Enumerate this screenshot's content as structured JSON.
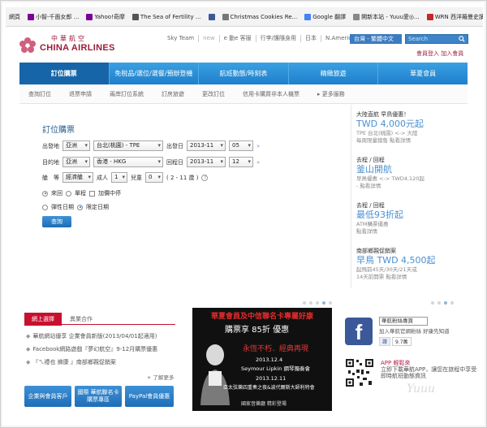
{
  "bookmarks": {
    "label": "網頁",
    "items": [
      {
        "label": "小智-千面女郎 ...",
        "icon": "yahoo-icon",
        "color": "#7b0099"
      },
      {
        "label": "Yahoo!奇摩",
        "icon": "yahoo-icon",
        "color": "#7b0099"
      },
      {
        "label": "The Sea of Fertility ...",
        "icon": "page-icon",
        "color": "#444444"
      },
      {
        "label": "",
        "icon": "facebook-icon",
        "color": "#3b5998"
      },
      {
        "label": "Christmas Cookies Re...",
        "icon": "page-icon",
        "color": "#444444"
      },
      {
        "label": "Google 翻譯",
        "icon": "google-icon",
        "color": "#4285f4"
      },
      {
        "label": "開新本站 - Yuuu愛◎...",
        "icon": "page-icon",
        "color": "#444444"
      },
      {
        "label": "WRN 西洋羅曼史讀...",
        "icon": "page-icon",
        "color": "#c62828"
      }
    ]
  },
  "header": {
    "logo_cn": "中華航空",
    "logo_en": "CHINA AIRLINES",
    "topnav": [
      "Sky Team",
      "new",
      "e 動e 客服",
      "行李/護隨身用",
      "日本",
      "N.America"
    ],
    "region": "台灣 - 繁體中文",
    "search_placeholder": "Search",
    "member_login": "會員登入",
    "join": "加入會員"
  },
  "mainnav": [
    "訂位購票",
    "免稅品/選位/選餐/預辦登機",
    "航班動態/時刻表",
    "精緻旅遊",
    "華夏會員"
  ],
  "subnav": [
    "查詢訂位",
    "退票申請",
    "兩岸訂位系統",
    "訂房旅遊",
    "更改訂位",
    "信用卡購買非本人機票",
    "更多服務"
  ],
  "booking": {
    "title": "訂位購票",
    "depart_label": "出發地",
    "depart_region": "亞洲",
    "depart_city": "台北(桃園) - TPE",
    "depart_date_label": "出發日",
    "depart_month": "2013-11",
    "depart_day": "05",
    "dest_label": "目的地",
    "dest_region": "亞洲",
    "dest_city": "香港 - HKG",
    "return_date_label": "回程日",
    "return_month": "2013-11",
    "return_day": "12",
    "cabin_label": "艙　等",
    "cabin_value": "經濟艙",
    "adult_label": "成人",
    "adult_count": "1",
    "child_label": "兒童",
    "child_count": "0",
    "child_age": "( 2 - 11 歲 )",
    "trip_roundtrip": "來回",
    "trip_oneway": "單程",
    "stopover": "加價中停",
    "flex_date": "彈性日期",
    "fixed_date": "限定日期",
    "query_button": "查詢"
  },
  "promos": [
    {
      "title": "大陸直航 早鳥優惠！",
      "price": "TWD 4,000元起",
      "lines": [
        "TPE 台北(桃園) <-> 大陸",
        "每周限量銷售 點看詳情"
      ]
    },
    {
      "title": "去程 / 回程",
      "price": "釜山開航",
      "lines": [
        "早鳥優惠 <-> TWD4,120起",
        "- 點看詳情"
      ]
    },
    {
      "title": "去程 / 回程",
      "price": "最低93折起",
      "lines": [
        "ATM購票優惠",
        "點看詳情"
      ]
    },
    {
      "title": "南部鄉親促銷案",
      "price": "早鳥 TWD 4,500起",
      "lines": [
        "起飛前45天/30天/21天或",
        "14天前開票 點看詳情"
      ]
    }
  ],
  "news": {
    "tab_active": "網上選擇",
    "tab_inactive": "異業合作",
    "items": [
      "華航網站優享 企業會員新版(2013/04/01起適用)",
      "Facebook網路遊戲『夢幻航空』9-12月購票優惠",
      "『ㄟ禮也 搞康 』南部鄉親促銷案"
    ],
    "more": "了解更多"
  },
  "buttons": [
    "企業與會員客戶",
    "國際 華航聯名卡\n購票專區",
    "PayPal會員優惠"
  ],
  "ad": {
    "title": "華夏會員及中信聯名卡專屬好康",
    "subtitle": "購票享 85折 優惠",
    "red_line": "永恆不朽．經典再現",
    "date1": "2013.12.4",
    "performer": "Seymour Lipkin 鋼琴獨奏會",
    "date2": "2013.12.11",
    "venue": "亞太弦樂四重奏之夜&波代爾斯大師利特會",
    "footer": "國家音樂廳 精彩登場"
  },
  "social": {
    "fb_letter": "f",
    "fan_page": "華航粉絲專頁",
    "fb_desc": "加入華航官網粉絲 好康先知道",
    "like_label": "讚",
    "like_count": "9.7萬",
    "app_title": "APP 輕鬆來",
    "app_desc": "立即下載華航APP，讓您在旅程中享受即時航班動態資訊"
  },
  "watermark": "Yuuu"
}
